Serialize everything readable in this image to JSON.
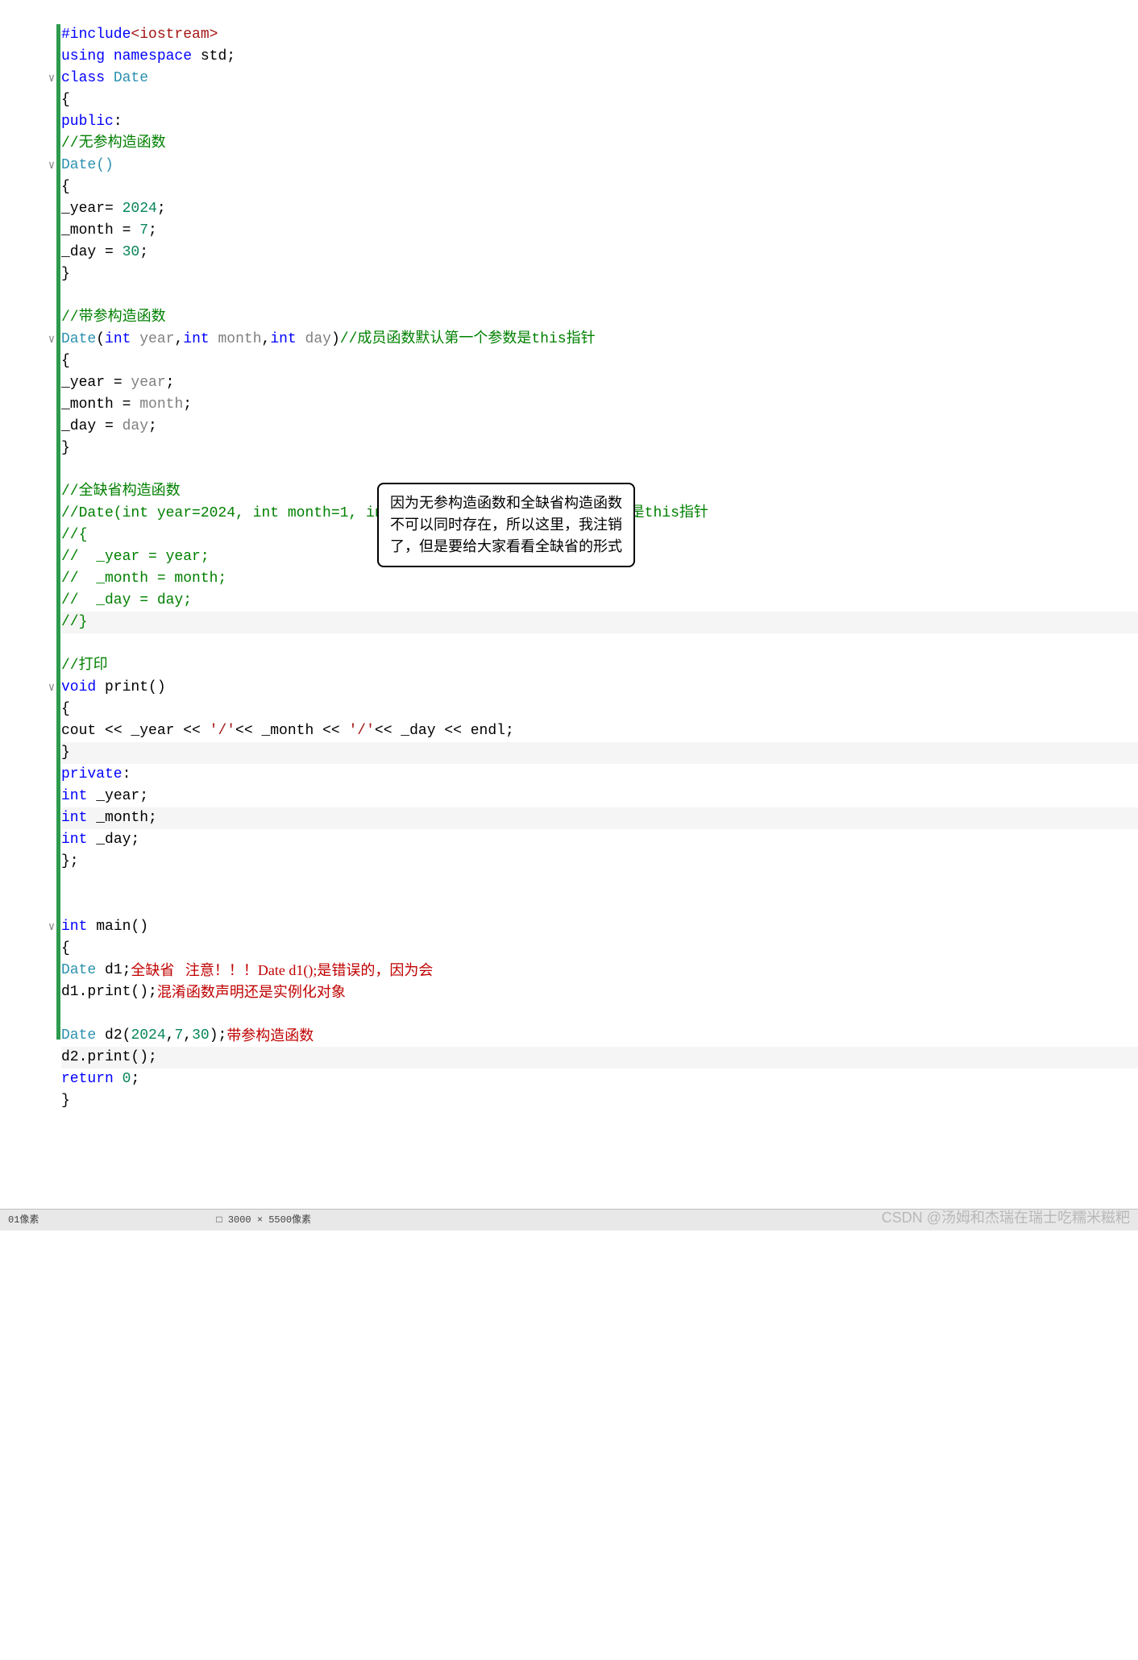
{
  "code": {
    "l1": {
      "pre": "#include",
      "ang": "<iostream>"
    },
    "l2": {
      "kw1": "using ",
      "kw2": "namespace ",
      "id": "std;"
    },
    "l3": {
      "kw": "class ",
      "cls": "Date"
    },
    "l4": "{",
    "l5": {
      "kw": "public",
      "colon": ":"
    },
    "l6": "//无参构造函数",
    "l7": "Date()",
    "l8": "{",
    "l9": {
      "id": "_year",
      "op": "= ",
      "num": "2024",
      "semi": ";"
    },
    "l10": {
      "id": "_month ",
      "op": "= ",
      "num": "7",
      "semi": ";"
    },
    "l11": {
      "id": "_day ",
      "op": "= ",
      "num": "30",
      "semi": ";"
    },
    "l12": "}",
    "l14": "//带参构造函数",
    "l15": {
      "cls": "Date",
      "p1": "(",
      "t": "int ",
      "a1": "year",
      "c1": ",",
      "a2": "month",
      "c2": ",",
      "a3": "day",
      "p2": ")",
      "cmt": "//成员函数默认第一个参数是this指针"
    },
    "l16": "{",
    "l17": {
      "id": "_year ",
      "op": "= ",
      "var": "year",
      "semi": ";"
    },
    "l18": {
      "id": "_month ",
      "op": "= ",
      "var": "month",
      "semi": ";"
    },
    "l19": {
      "id": "_day ",
      "op": "= ",
      "var": "day",
      "semi": ";"
    },
    "l20": "}",
    "l22": "//全缺省构造函数",
    "l23": "//Date(int year=2024, int month=1, int day=1)//成员函数默认第一个参数是this指针",
    "l24": "//{",
    "l25": "//  _year = year;",
    "l26": "//  _month = month;",
    "l27": "//  _day = day;",
    "l28": "//}",
    "l30": "//打印",
    "l31": {
      "kw": "void ",
      "fn": "print",
      "paren": "()"
    },
    "l32": "{",
    "l33": {
      "c1": "cout ",
      "op": "<< ",
      "id1": "_year ",
      "s1": "'/'",
      "id2": "_month ",
      "s2": "'/'",
      "id3": "_day ",
      "e": "endl",
      "semi": ";"
    },
    "l34": "}",
    "l35": {
      "kw": "private",
      "colon": ":"
    },
    "l36": {
      "t": "int ",
      "id": "_year;"
    },
    "l37": {
      "t": "int ",
      "id": "_month;"
    },
    "l38": {
      "t": "int ",
      "id": "_day;"
    },
    "l39": "};",
    "l42": {
      "t": "int ",
      "fn": "main",
      "paren": "()"
    },
    "l43": "{",
    "l44": {
      "cls": "Date ",
      "id": "d1;"
    },
    "l45": {
      "id": "d1.",
      "fn": "print",
      "paren": "();"
    },
    "l47": {
      "cls": "Date ",
      "id": "d2",
      "p": "(",
      "n1": "2024",
      "c": ",",
      "n2": "7",
      "n3": "30",
      "p2": ");"
    },
    "l48": {
      "id": "d2.",
      "fn": "print",
      "paren": "();"
    },
    "l49": {
      "kw": "return ",
      "num": "0",
      "semi": ";"
    },
    "l50": "}"
  },
  "notes": {
    "callout1": "因为无参构造函数和全缺省构造函数不可以同时存在，所以这里，我注销了，但是要给大家看看全缺省的形式",
    "red1": "全缺省   注意！！！",
    "red2a": "Date d1();是错误的，因为会",
    "red2b": "混淆函数声明还是实例化对象",
    "red3": "带参构造函数"
  },
  "bottom": {
    "left": "01像素",
    "right": "3000 × 5500像素"
  },
  "watermark": "CSDN @汤姆和杰瑞在瑞士吃糯米糍粑"
}
